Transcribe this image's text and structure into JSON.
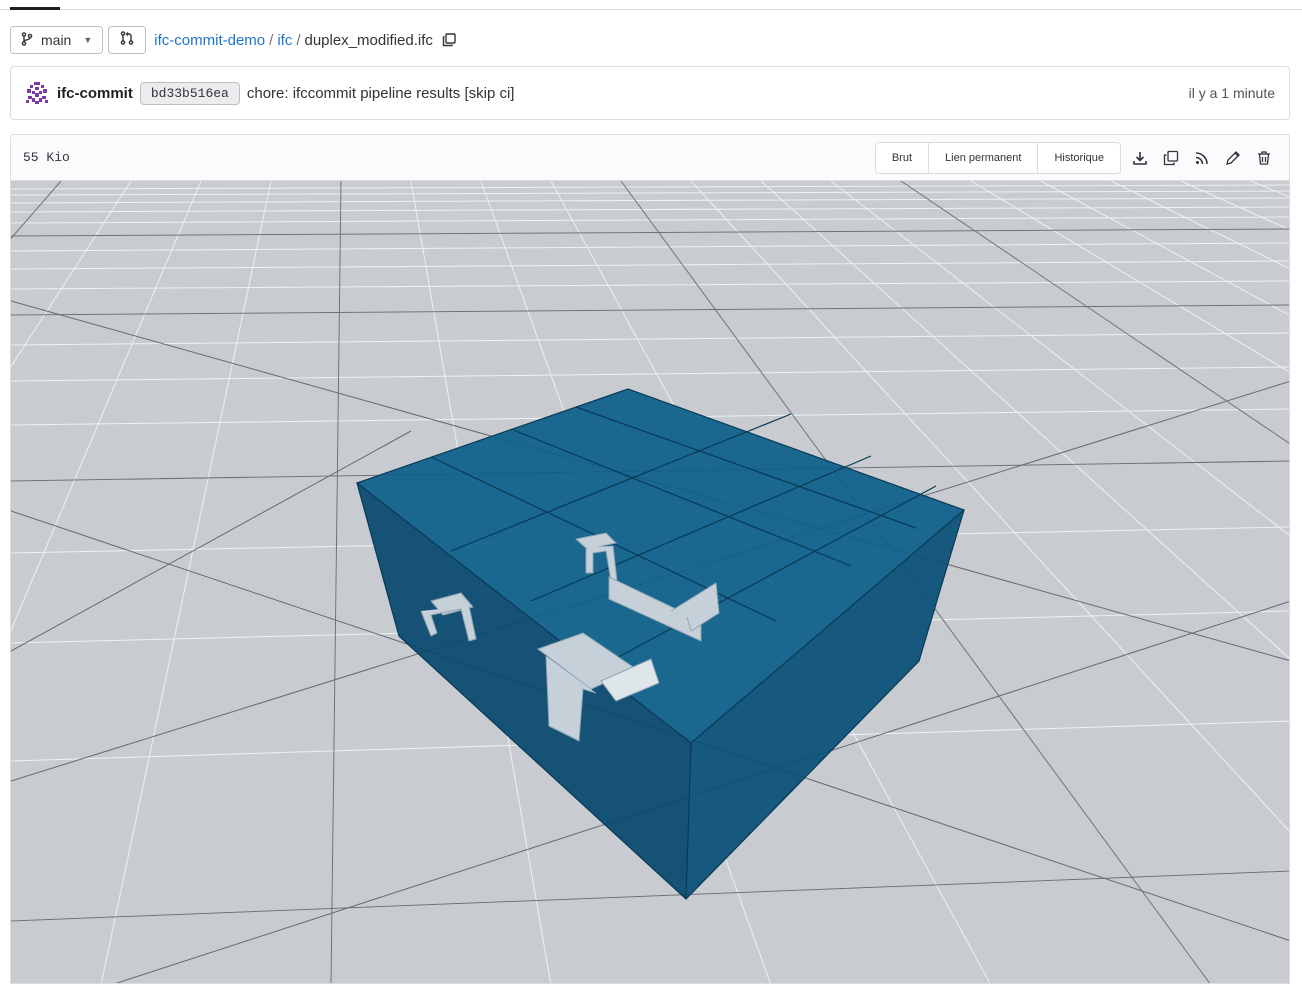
{
  "repo": {
    "branch": "main",
    "breadcrumb": [
      "ifc-commit-demo",
      "ifc"
    ],
    "file_name": "duplex_modified.ifc"
  },
  "commit": {
    "author": "ifc-commit",
    "sha": "bd33b516ea",
    "message": "chore: ifccommit pipeline results [skip ci]",
    "time": "il y a 1 minute"
  },
  "file": {
    "size": "55 Kio",
    "buttons": {
      "raw": "Brut",
      "permalink": "Lien permanent",
      "history": "Historique"
    },
    "icons": [
      "download-icon",
      "copy-contents-icon",
      "rss-feed-icon",
      "edit-pencil-icon",
      "delete-trash-icon"
    ]
  },
  "colors": {
    "link": "#1f75cb",
    "model_blue": "#0b5b86",
    "grid_bg": "#c8ccd0"
  }
}
